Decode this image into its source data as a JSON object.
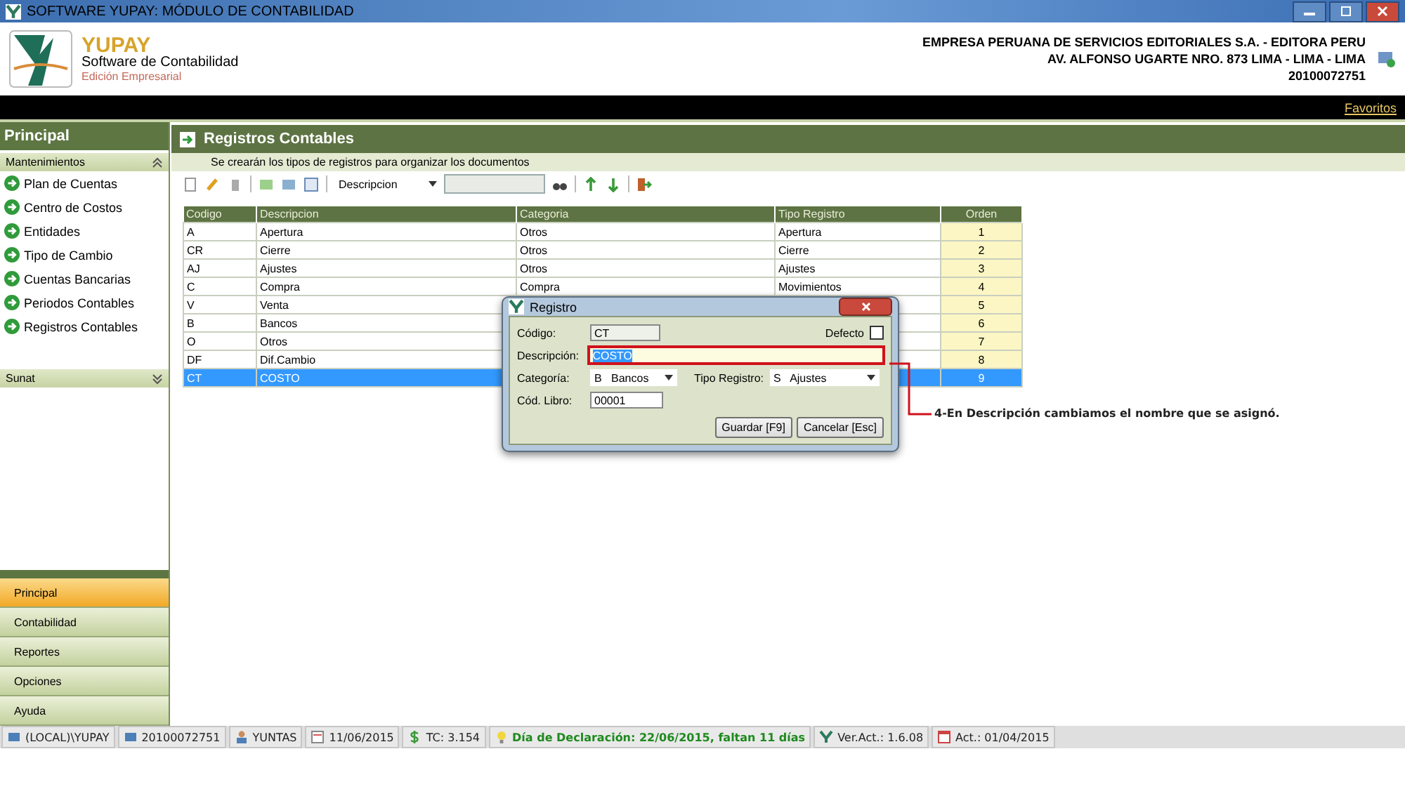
{
  "window": {
    "title": "SOFTWARE YUPAY: MÓDULO DE CONTABILIDAD"
  },
  "header": {
    "brand": "YUPAY",
    "product": "Software de Contabilidad",
    "edition": "Edición Empresarial",
    "company": [
      "EMPRESA PERUANA DE SERVICIOS EDITORIALES S.A. - EDITORA PERU",
      "AV. ALFONSO UGARTE NRO. 873 LIMA - LIMA - LIMA",
      "20100072751"
    ]
  },
  "menu_bar": {
    "link": "Favoritos"
  },
  "sidebar": {
    "title": "Principal",
    "sections": [
      {
        "label": "Mantenimientos",
        "expanded": true,
        "items": [
          "Plan de Cuentas",
          "Centro de Costos",
          "Entidades",
          "Tipo de Cambio",
          "Cuentas Bancarias",
          "Periodos Contables",
          "Registros Contables"
        ]
      },
      {
        "label": "Sunat",
        "expanded": false
      }
    ],
    "nav": [
      {
        "label": "Principal",
        "selected": true
      },
      {
        "label": "Contabilidad",
        "selected": false
      },
      {
        "label": "Reportes",
        "selected": false
      },
      {
        "label": "Opciones",
        "selected": false
      },
      {
        "label": "Ayuda",
        "selected": false
      }
    ]
  },
  "main": {
    "title": "Registros Contables",
    "subtitle": "Se crearán los tipos de registros para organizar los documentos",
    "toolbar": {
      "search_field": "Descripcion"
    },
    "table": {
      "columns": [
        "Codigo",
        "Descripcion",
        "Categoria",
        "Tipo Registro",
        "Orden"
      ],
      "rows": [
        {
          "cells": [
            "A",
            "Apertura",
            "Otros",
            "Apertura",
            "1"
          ],
          "selected": false
        },
        {
          "cells": [
            "CR",
            "Cierre",
            "Otros",
            "Cierre",
            "2"
          ],
          "selected": false
        },
        {
          "cells": [
            "AJ",
            "Ajustes",
            "Otros",
            "Ajustes",
            "3"
          ],
          "selected": false
        },
        {
          "cells": [
            "C",
            "Compra",
            "Compra",
            "Movimientos",
            "4"
          ],
          "selected": false
        },
        {
          "cells": [
            "V",
            "Venta",
            null,
            null,
            "5"
          ],
          "selected": false
        },
        {
          "cells": [
            "B",
            "Bancos",
            null,
            null,
            "6"
          ],
          "selected": false
        },
        {
          "cells": [
            "O",
            "Otros",
            null,
            null,
            "7"
          ],
          "selected": false
        },
        {
          "cells": [
            "DF",
            "Dif.Cambio",
            null,
            null,
            "8"
          ],
          "selected": false
        },
        {
          "cells": [
            "CT",
            "COSTO",
            null,
            null,
            "9"
          ],
          "selected": true
        }
      ]
    }
  },
  "dialog": {
    "title": "Registro",
    "codigo_label": "Código:",
    "codigo": "CT",
    "defecto_label": "Defecto",
    "defecto_checked": false,
    "descripcion_label": "Descripción:",
    "descripcion": "COSTO",
    "categoria_label": "Categoría:",
    "categoria": "B   Bancos",
    "tipo_label": "Tipo Registro:",
    "tipo": "S   Ajustes",
    "libro_label": "Cód. Libro:",
    "libro": "00001",
    "buttons": [
      "Guardar [F9]",
      "Cancelar [Esc]"
    ]
  },
  "annotation": "4-En Descripción cambiamos el nombre que se asignó.",
  "status_bar": [
    {
      "kind": "server",
      "text": "(LOCAL)\\YUPAY"
    },
    {
      "kind": "server",
      "text": "20100072751"
    },
    {
      "kind": "user",
      "text": "YUNTAS"
    },
    {
      "kind": "calendar",
      "text": "11/06/2015"
    },
    {
      "kind": "money",
      "text": "TC: 3.154"
    },
    {
      "kind": "alert",
      "text": "Día de Declaración: 22/06/2015, faltan 11 días"
    },
    {
      "kind": "version",
      "text": "Ver.Act.: 1.6.08"
    },
    {
      "kind": "update",
      "text": "Act.: 01/04/2015"
    }
  ]
}
